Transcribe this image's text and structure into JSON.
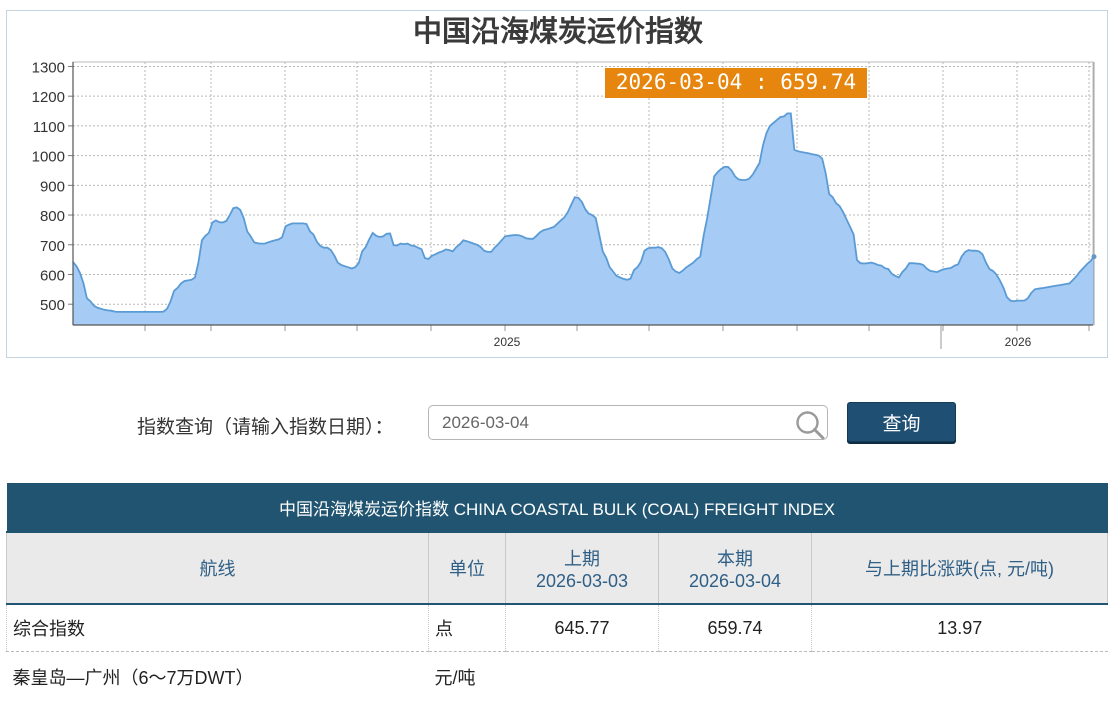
{
  "chart_data": {
    "type": "area",
    "title": "中国沿海煤炭运价指数",
    "y_ticks": [
      500,
      600,
      700,
      800,
      900,
      1000,
      1100,
      1200,
      1300
    ],
    "ylim": [
      430,
      1315
    ],
    "x_tick_labels": [
      {
        "label": "2025",
        "year": 2025
      },
      {
        "label": "2026",
        "year": 2026
      }
    ],
    "grid": true,
    "fill_color": "#a6cbf4",
    "line_color": "#5b9bd5",
    "tooltip": "2026-03-04 : 659.74",
    "tooltip_color": "#e7860f",
    "series": [
      {
        "values": [
          642,
          628,
          605,
          570,
          520,
          510,
          495,
          488,
          485,
          481,
          479,
          478,
          475,
          474,
          474,
          474,
          474,
          474,
          474,
          474,
          474,
          474,
          474,
          474,
          474,
          474,
          475,
          485,
          510,
          545,
          555,
          570,
          578,
          580,
          582,
          590,
          640,
          715,
          730,
          740,
          775,
          782,
          776,
          775,
          780,
          800,
          823,
          826,
          817,
          790,
          745,
          728,
          708,
          705,
          704,
          704,
          708,
          712,
          715,
          718,
          725,
          762,
          768,
          772,
          772,
          772,
          772,
          770,
          745,
          735,
          710,
          696,
          690,
          690,
          682,
          664,
          640,
          632,
          628,
          624,
          620,
          625,
          638,
          678,
          692,
          718,
          740,
          730,
          726,
          728,
          737,
          738,
          699,
          698,
          704,
          702,
          704,
          698,
          696,
          690,
          685,
          655,
          652,
          663,
          668,
          674,
          678,
          684,
          682,
          678,
          692,
          702,
          715,
          712,
          708,
          704,
          700,
          692,
          680,
          676,
          676,
          690,
          702,
          715,
          728,
          730,
          732,
          733,
          732,
          728,
          722,
          720,
          720,
          730,
          742,
          749,
          752,
          756,
          760,
          771,
          782,
          792,
          810,
          835,
          860,
          858,
          845,
          820,
          805,
          800,
          790,
          735,
          678,
          656,
          625,
          610,
          595,
          590,
          585,
          582,
          586,
          615,
          625,
          643,
          680,
          688,
          690,
          690,
          692,
          688,
          675,
          650,
          620,
          610,
          605,
          613,
          624,
          632,
          640,
          652,
          660,
          732,
          790,
          860,
          930,
          945,
          955,
          962,
          962,
          950,
          930,
          920,
          918,
          918,
          922,
          935,
          955,
          975,
          1035,
          1075,
          1100,
          1110,
          1120,
          1130,
          1132,
          1142,
          1142,
          1020,
          1015,
          1012,
          1010,
          1008,
          1005,
          1003,
          1000,
          990,
          940,
          870,
          860,
          840,
          830,
          810,
          785,
          760,
          735,
          648,
          638,
          637,
          638,
          640,
          637,
          632,
          630,
          621,
          618,
          602,
          595,
          590,
          608,
          620,
          638,
          638,
          637,
          636,
          632,
          620,
          612,
          610,
          608,
          614,
          618,
          620,
          622,
          630,
          634,
          660,
          676,
          682,
          680,
          680,
          678,
          668,
          640,
          618,
          612,
          600,
          580,
          556,
          524,
          512,
          510,
          512,
          512,
          512,
          520,
          538,
          550,
          552,
          554,
          556,
          558,
          560,
          562,
          564,
          566,
          568,
          570,
          582,
          595,
          610,
          622,
          635,
          645,
          659.74
        ]
      }
    ]
  },
  "query": {
    "label": "指数查询（请输入指数日期）：",
    "input_value": "2026-03-04",
    "button_label": "查询"
  },
  "table": {
    "caption": "中国沿海煤炭运价指数 CHINA COASTAL BULK (COAL) FREIGHT INDEX",
    "headers": {
      "route": "航线",
      "unit": "单位",
      "prev_label": "上期",
      "prev_date": "2026-03-03",
      "curr_label": "本期",
      "curr_date": "2026-03-04",
      "change": "与上期比涨跌(点, 元/吨)"
    },
    "rows": [
      {
        "route": "综合指数",
        "unit": "点",
        "prev": "645.77",
        "curr": "659.74",
        "change": "13.97"
      }
    ],
    "partial_row": {
      "route": "秦皇岛—广州（6～7万DWT）",
      "unit": "元/吨"
    }
  }
}
